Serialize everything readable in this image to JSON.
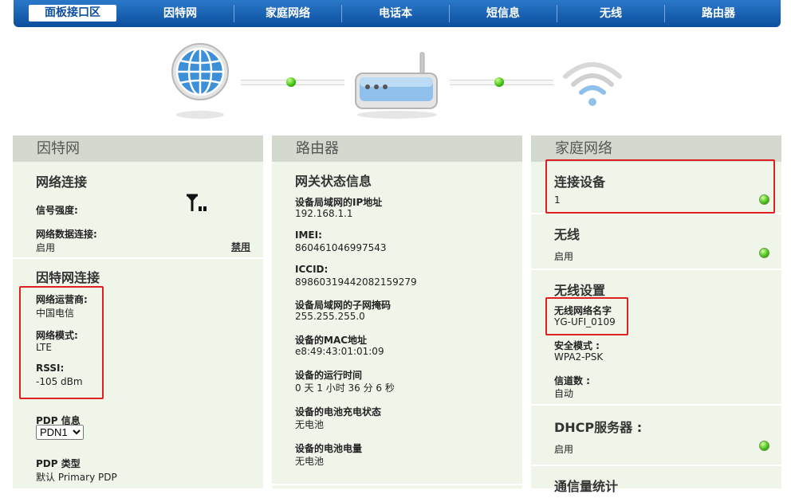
{
  "nav": {
    "items": [
      "面板接口区",
      "因特网",
      "家庭网络",
      "电话本",
      "短信息",
      "无线",
      "路由器"
    ],
    "active_index": 0
  },
  "internet": {
    "title": "因特网",
    "network_connection": {
      "heading": "网络连接",
      "signal_label": "信号强度:",
      "data_label": "网络数据连接:",
      "data_value": "启用",
      "disable_link": "禁用"
    },
    "internet_connection": {
      "heading": "因特网连接",
      "operator_label": "网络运营商:",
      "operator_value": "中国电信",
      "mode_label": "网络模式:",
      "mode_value": "LTE",
      "rssi_label": "RSSI:",
      "rssi_value": "-105 dBm",
      "pdp_info_label": "PDP 信息",
      "pdp_selected": "PDN1",
      "pdp_type_label": "PDP 类型",
      "pdp_type_value": "默认 Primary PDP"
    }
  },
  "router": {
    "title": "路由器",
    "heading": "网关状态信息",
    "fields": [
      {
        "label": "设备局域网的IP地址",
        "value": "192.168.1.1"
      },
      {
        "label": "IMEI:",
        "value": "860461046997543"
      },
      {
        "label": "ICCID:",
        "value": "89860319442082159279"
      },
      {
        "label": "设备局域网的子网掩码",
        "value": "255.255.255.0"
      },
      {
        "label": "设备的MAC地址",
        "value": "e8:49:43:01:01:09"
      },
      {
        "label": "设备的运行时间",
        "value": "0 天 1 小时 36 分 6 秒"
      },
      {
        "label": "设备的电池充电状态",
        "value": "无电池"
      },
      {
        "label": "设备的电池电量",
        "value": "无电池"
      }
    ]
  },
  "home": {
    "title": "家庭网络",
    "connected_devices": {
      "heading": "连接设备",
      "value": "1"
    },
    "wireless": {
      "heading": "无线",
      "value": "启用"
    },
    "wireless_settings": {
      "heading": "无线设置",
      "ssid_label": "无线网络名字",
      "ssid_value": "YG-UFI_0109",
      "security_label": "安全模式 :",
      "security_value": "WPA2-PSK",
      "channel_label": "信道数 :",
      "channel_value": "自动"
    },
    "dhcp": {
      "heading": "DHCP服务器 :",
      "value": "启用"
    },
    "traffic": {
      "heading": "通信量统计"
    }
  },
  "colors": {
    "nav_top": "#2b78c8",
    "nav_bottom": "#0c4e9e",
    "panel_bg": "#f0f5ea",
    "panel_head": "#d4d9d0",
    "status_green": "#4cc41d",
    "highlight_red": "#e02020"
  }
}
